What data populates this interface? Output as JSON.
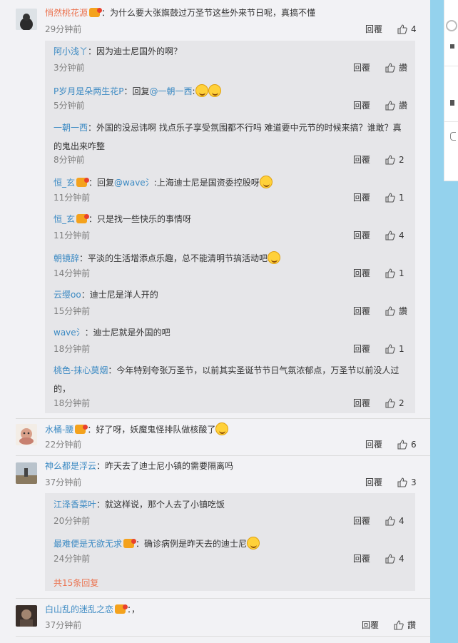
{
  "ui": {
    "reply_label": "回覆",
    "like_label_empty": "讚",
    "like_icon": "thumbs-up-icon",
    "vip_icon": "vip-badge-icon",
    "emoji_icon": "laughing-face-emoji"
  },
  "comments": [
    {
      "name": "悄然桃花源",
      "text": "：为什么要大张旗鼓过万圣节这些外来节日呢，真搞不懂",
      "time": "29分钟前",
      "likes": "4"
    },
    {
      "name": "水桶-腰",
      "text": "：好了呀，妖魔鬼怪排队做核酸了",
      "time": "22分钟前",
      "likes": "6"
    },
    {
      "name": "神么都是浮云",
      "text": "：昨天去了迪士尼小镇的需要隔离吗",
      "time": "37分钟前",
      "likes": "3"
    },
    {
      "name": "白山乱的迷乱之恋",
      "text": "：，",
      "time": "37分钟前",
      "likes": "讚"
    }
  ],
  "replies_a": [
    {
      "name": "阿小浅丫",
      "text": "：因为迪士尼国外的啊？",
      "time": "3分钟前",
      "likes": "讚"
    },
    {
      "name": "P岁月是朵两生花P",
      "text": "：回复",
      "mention": "@一朝一西",
      "tail": ":",
      "time": "5分钟前",
      "likes": "讚"
    },
    {
      "name": "一朝一西",
      "text": "：外国的没忌讳啊 找点乐子享受氛围都不行吗 难道要中元节的时候来搞？谁敢？真的鬼出来咋整",
      "time": "8分钟前",
      "likes": "2"
    },
    {
      "name": "恒_玄",
      "text": "：回复",
      "mention": "@wave氵",
      "tail": ":上海迪士尼是国资委控股呀",
      "time": "11分钟前",
      "likes": "1"
    },
    {
      "name": "恒_玄",
      "text": "：只是找一些快乐的事情呀",
      "time": "11分钟前",
      "likes": "4"
    },
    {
      "name": "朝镜辞",
      "text": "：平淡的生活增添点乐趣，总不能清明节搞活动吧",
      "time": "14分钟前",
      "likes": "1"
    },
    {
      "name": "云缨oo",
      "text": "：迪士尼是洋人开的",
      "time": "15分钟前",
      "likes": "讚"
    },
    {
      "name": "wave氵",
      "text": "：迪士尼就是外国的吧",
      "time": "18分钟前",
      "likes": "1"
    },
    {
      "name": "桃色-抹心莫烟",
      "text": "：今年特别夸张万圣节，以前其实圣诞节节日气氛浓郁点，万圣节以前没人过的，",
      "time": "18分钟前",
      "likes": "2"
    }
  ],
  "replies_b": [
    {
      "name": "江泽香菜叶",
      "text": "：就这样说，那个人去了小镇吃饭",
      "time": "20分钟前",
      "likes": "4"
    },
    {
      "name": "最难便是无欲无求",
      "text": "：确诊病例是昨天去的迪士尼",
      "time": "24分钟前",
      "likes": "4"
    }
  ],
  "more_replies": "共15条回复"
}
